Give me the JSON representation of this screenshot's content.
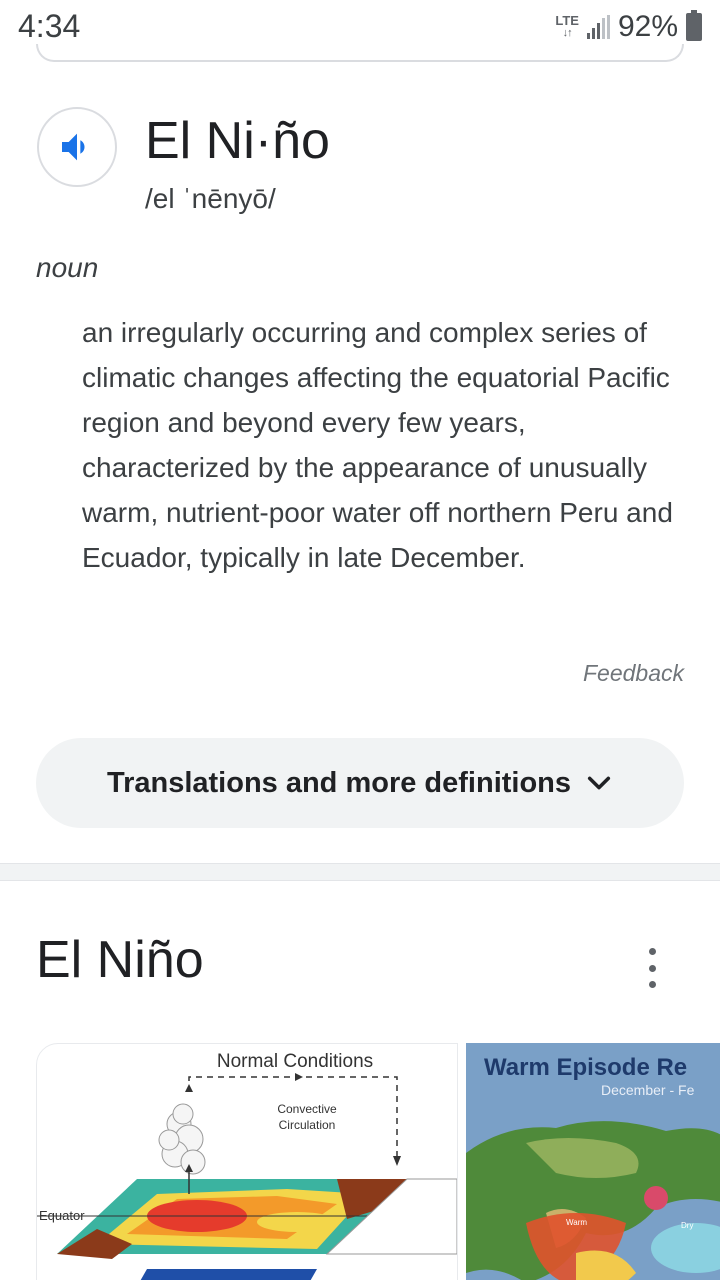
{
  "status_bar": {
    "time": "4:34",
    "network": "LTE",
    "battery": "92%"
  },
  "dictionary": {
    "speaker_icon": "speaker-icon",
    "headword": "El Ni·ño",
    "phonetic": "/el ˈnēnyō/",
    "part_of_speech": "noun",
    "definition": "an irregularly occurring and complex series of climatic changes affecting the equatorial Pacific region and beyond every few years, characterized by the appearance of unusually warm, nutrient-poor water off northern Peru and Ecuador, typically in late December.",
    "feedback": "Feedback",
    "more_button": "Translations and more definitions"
  },
  "knowledge_panel": {
    "title": "El Niño",
    "images": [
      {
        "title": "Normal Conditions",
        "label_convective": "Convective",
        "label_circulation": "Circulation",
        "label_equator": "Equator"
      },
      {
        "title": "Warm Episode Re",
        "subtitle": "December - Fe",
        "label_warm": "Warm",
        "label_dry": "Dry"
      }
    ]
  },
  "colors": {
    "accent_blue": "#1a73e8",
    "button_bg": "#f1f3f4",
    "text_primary": "#202124",
    "text_secondary": "#3c4043"
  }
}
